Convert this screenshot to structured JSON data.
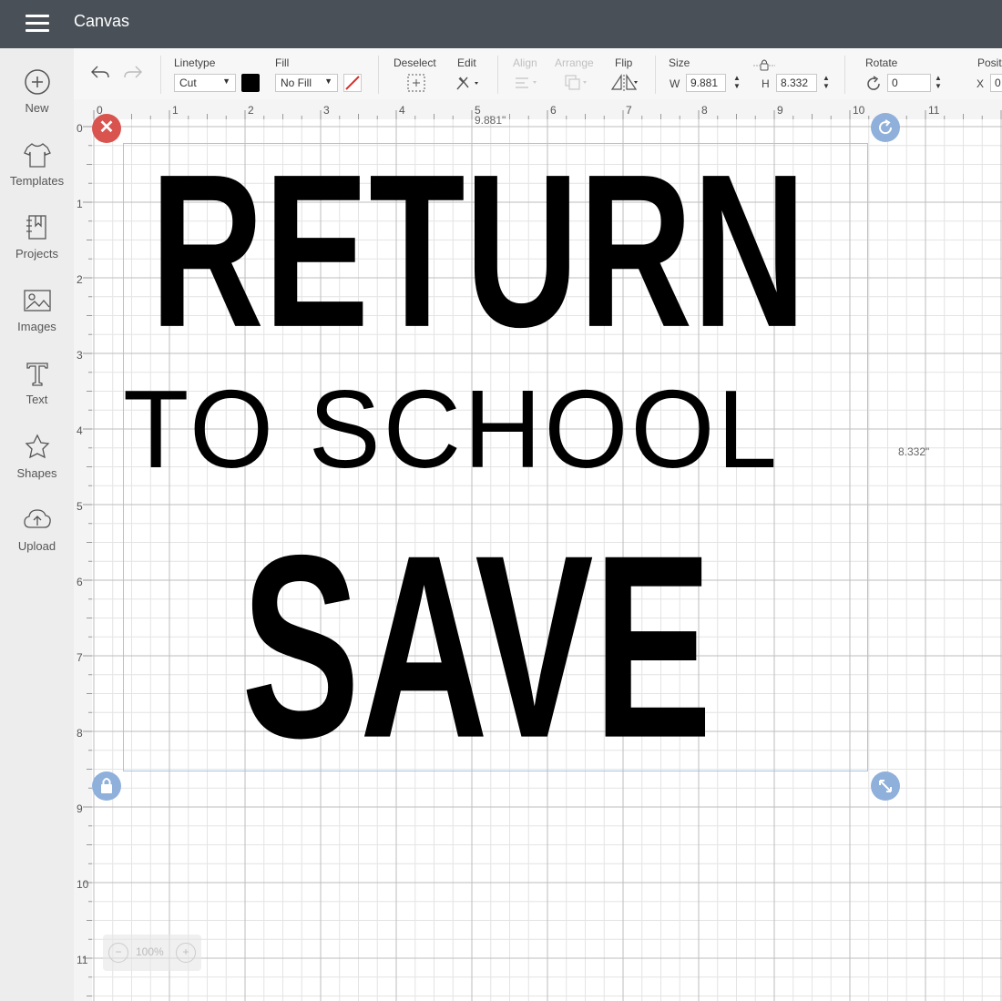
{
  "app": {
    "title": "Canvas"
  },
  "sidebar": {
    "items": [
      {
        "label": "New",
        "icon": "plus-circle-icon"
      },
      {
        "label": "Templates",
        "icon": "tshirt-icon"
      },
      {
        "label": "Projects",
        "icon": "projects-icon"
      },
      {
        "label": "Images",
        "icon": "image-icon"
      },
      {
        "label": "Text",
        "icon": "text-icon"
      },
      {
        "label": "Shapes",
        "icon": "shapes-icon"
      },
      {
        "label": "Upload",
        "icon": "upload-cloud-icon"
      }
    ]
  },
  "toolbar": {
    "linetype_label": "Linetype",
    "linetype_value": "Cut",
    "fill_label": "Fill",
    "fill_value": "No Fill",
    "deselect_label": "Deselect",
    "edit_label": "Edit",
    "align_label": "Align",
    "arrange_label": "Arrange",
    "flip_label": "Flip",
    "size_label": "Size",
    "w_label": "W",
    "w_value": "9.881",
    "h_label": "H",
    "h_value": "8.332",
    "rotate_label": "Rotate",
    "rotate_value": "0",
    "position_label": "Positi",
    "x_label": "X",
    "x_value": "0"
  },
  "colors": {
    "topbar": "#495057",
    "swatch": "#000000",
    "delete_badge": "#d9534f",
    "handle": "#8fb0db",
    "selection": "#a9c3e3"
  },
  "canvas": {
    "ruler_numbers": [
      "0",
      "1",
      "2",
      "3",
      "4",
      "5",
      "6",
      "7",
      "8",
      "9",
      "10",
      "11"
    ],
    "width_readout": "9.881\"",
    "height_readout": "8.332\"",
    "zoom": "100%",
    "design": {
      "line1": "RETURN",
      "line2": "TO SCHOOL",
      "line3": "SAVE"
    }
  }
}
